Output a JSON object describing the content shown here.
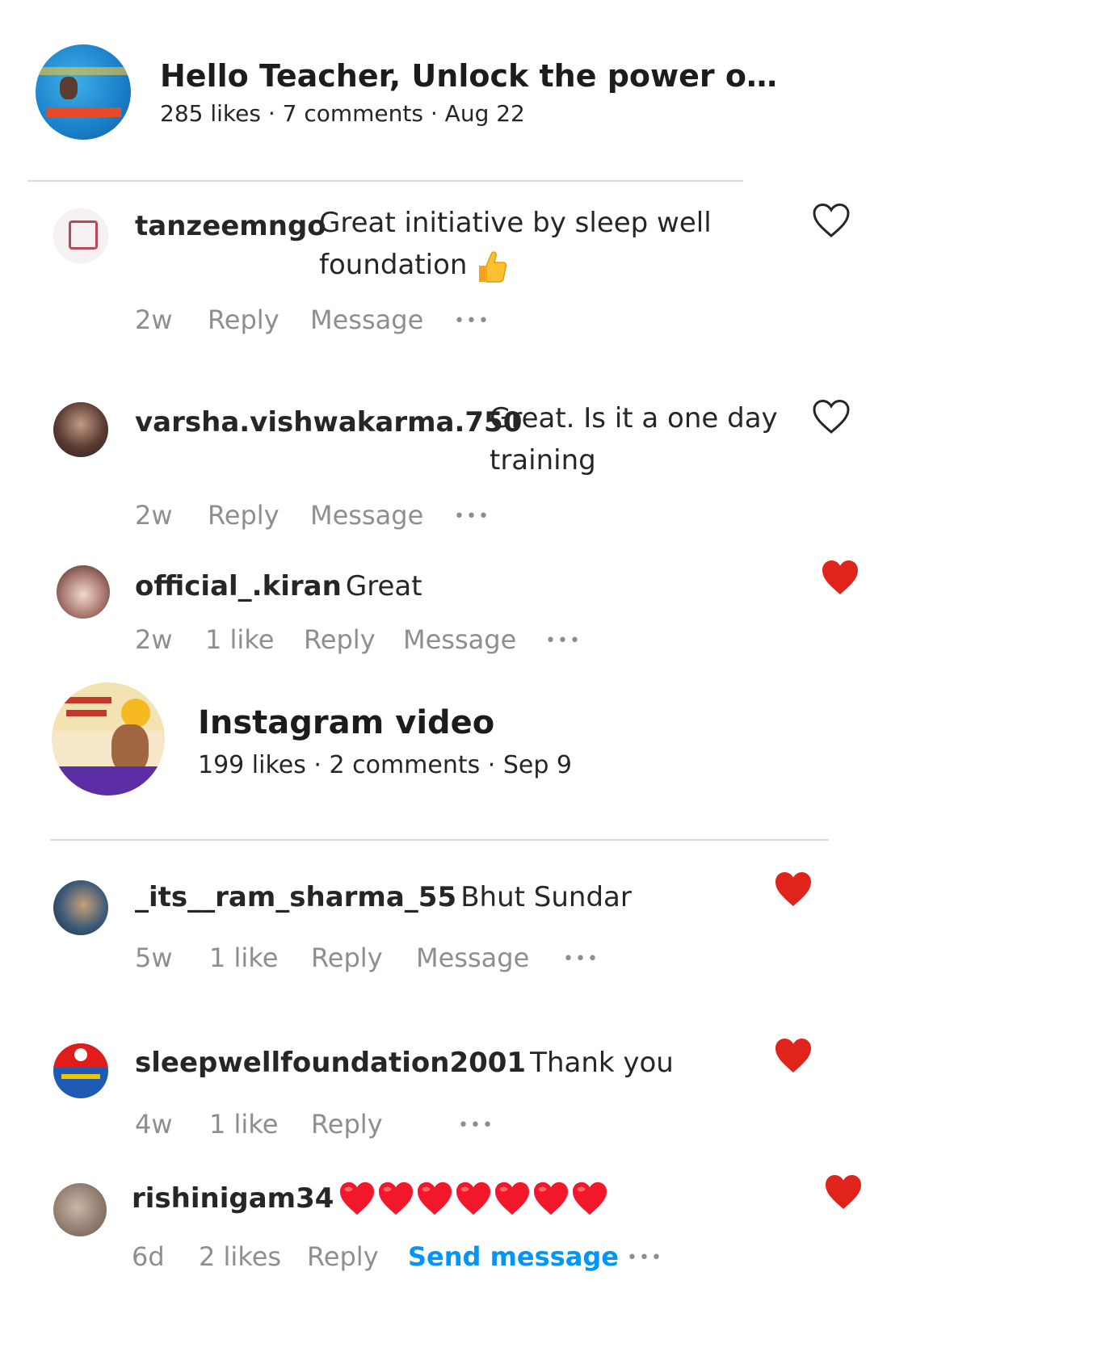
{
  "colors": {
    "heart_red": "#ed4956",
    "link_blue": "#0095f6",
    "muted": "#8e8e8e"
  },
  "posts": [
    {
      "title": "Hello Teacher, Unlock the power o…",
      "meta": "285 likes · 7 comments · Aug 22",
      "comments": [
        {
          "username": "tanzeemngo",
          "text_line1": "Great initiative by sleep well",
          "text_line2": "foundation",
          "emoji": "thumbs-up-icon",
          "time": "2w",
          "reply": "Reply",
          "message": "Message",
          "more": "•••",
          "liked": false
        },
        {
          "username": "varsha.vishwakarma.750",
          "text_line1": "Great. Is it a one day",
          "text_line2": "training",
          "time": "2w",
          "reply": "Reply",
          "message": "Message",
          "more": "•••",
          "liked": false
        },
        {
          "username": "official_.kiran",
          "text": "Great",
          "time": "2w",
          "likes": "1 like",
          "reply": "Reply",
          "message": "Message",
          "more": "•••",
          "liked": true
        }
      ]
    },
    {
      "title": "Instagram video",
      "meta": "199 likes · 2 comments · Sep 9",
      "comments": [
        {
          "username": "_its__ram_sharma_55",
          "text": "Bhut Sundar",
          "time": "5w",
          "likes": "1 like",
          "reply": "Reply",
          "message": "Message",
          "more": "•••",
          "liked": true
        },
        {
          "username": "sleepwellfoundation2001",
          "text": "Thank you",
          "time": "4w",
          "likes": "1 like",
          "reply": "Reply",
          "more": "•••",
          "liked": true
        },
        {
          "username": "rishinigam34",
          "emoji": "red-heart-icon",
          "emoji_count": 7,
          "time": "6d",
          "likes": "2 likes",
          "reply": "Reply",
          "send_message": "Send message",
          "more": "•••",
          "liked": true
        }
      ]
    }
  ]
}
